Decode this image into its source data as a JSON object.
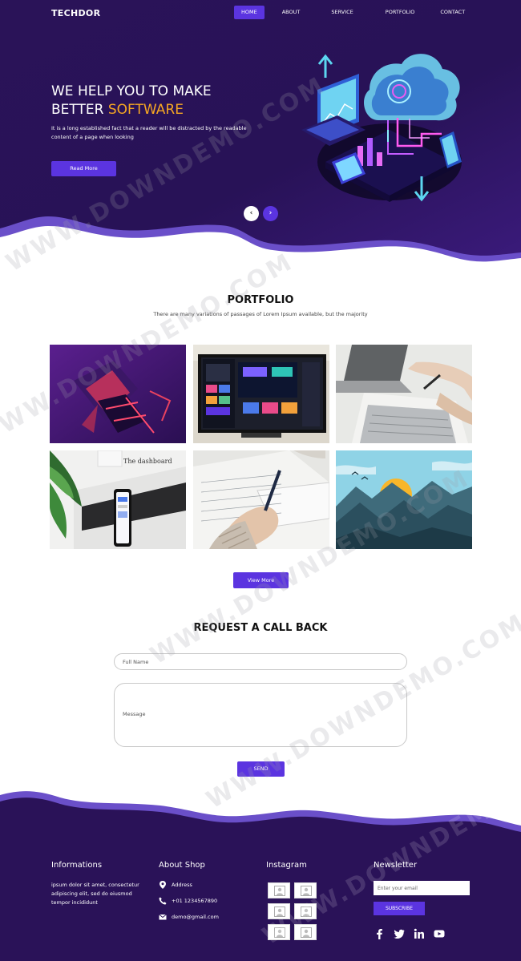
{
  "brand": {
    "name": "TECHDOR",
    "accent": "#5b34e0",
    "highlight": "#f5a623",
    "hero_dark": "#2a1258"
  },
  "nav": {
    "items": [
      {
        "label": "HOME",
        "active": true
      },
      {
        "label": "ABOUT",
        "active": false
      },
      {
        "label": "SERVICE",
        "active": false
      },
      {
        "label": "PORTFOLIO",
        "active": false
      },
      {
        "label": "CONTACT",
        "active": false
      }
    ]
  },
  "hero": {
    "title_line1": "WE HELP YOU TO MAKE",
    "title_line2_plain": "BETTER ",
    "title_line2_accent": "SOFTWARE",
    "description": "It is a long established fact that a reader will be distracted by the readable content of a page when looking",
    "cta_label": "Read More",
    "prev_icon": "‹",
    "next_icon": "›"
  },
  "portfolio": {
    "title": "PORTFOLIO",
    "subtitle": "There are many variations of passages of Lorem Ipsum available, but the majority",
    "tiles": [
      {
        "name": "abstract-purple"
      },
      {
        "name": "monitor-design"
      },
      {
        "name": "laptop-notes"
      },
      {
        "name": "dashboard-phone"
      },
      {
        "name": "hand-writing"
      },
      {
        "name": "mountain-sunset"
      }
    ],
    "dashboard_caption": "The dashboard",
    "view_more_label": "View More"
  },
  "request": {
    "title": "REQUEST A CALL BACK",
    "name_placeholder": "Full Name",
    "message_placeholder": "Message",
    "send_label": "SEND"
  },
  "footer": {
    "informations": {
      "heading": "Informations",
      "text": "ipsum dolor sit amet, consectetur adipiscing elit, sed do eiusmod tempor incididunt"
    },
    "about_shop": {
      "heading": "About Shop",
      "address": "Address",
      "phone": "+01 1234567890",
      "email": "demo@gmail.com"
    },
    "instagram": {
      "heading": "Instagram"
    },
    "newsletter": {
      "heading": "Newsletter",
      "email_placeholder": "Enter your email",
      "subscribe_label": "SUBSCRIBE"
    },
    "social_icons": [
      "facebook-icon",
      "twitter-icon",
      "linkedin-icon",
      "youtube-icon"
    ]
  },
  "watermark": "WWW.DOWNDEMO.COM"
}
